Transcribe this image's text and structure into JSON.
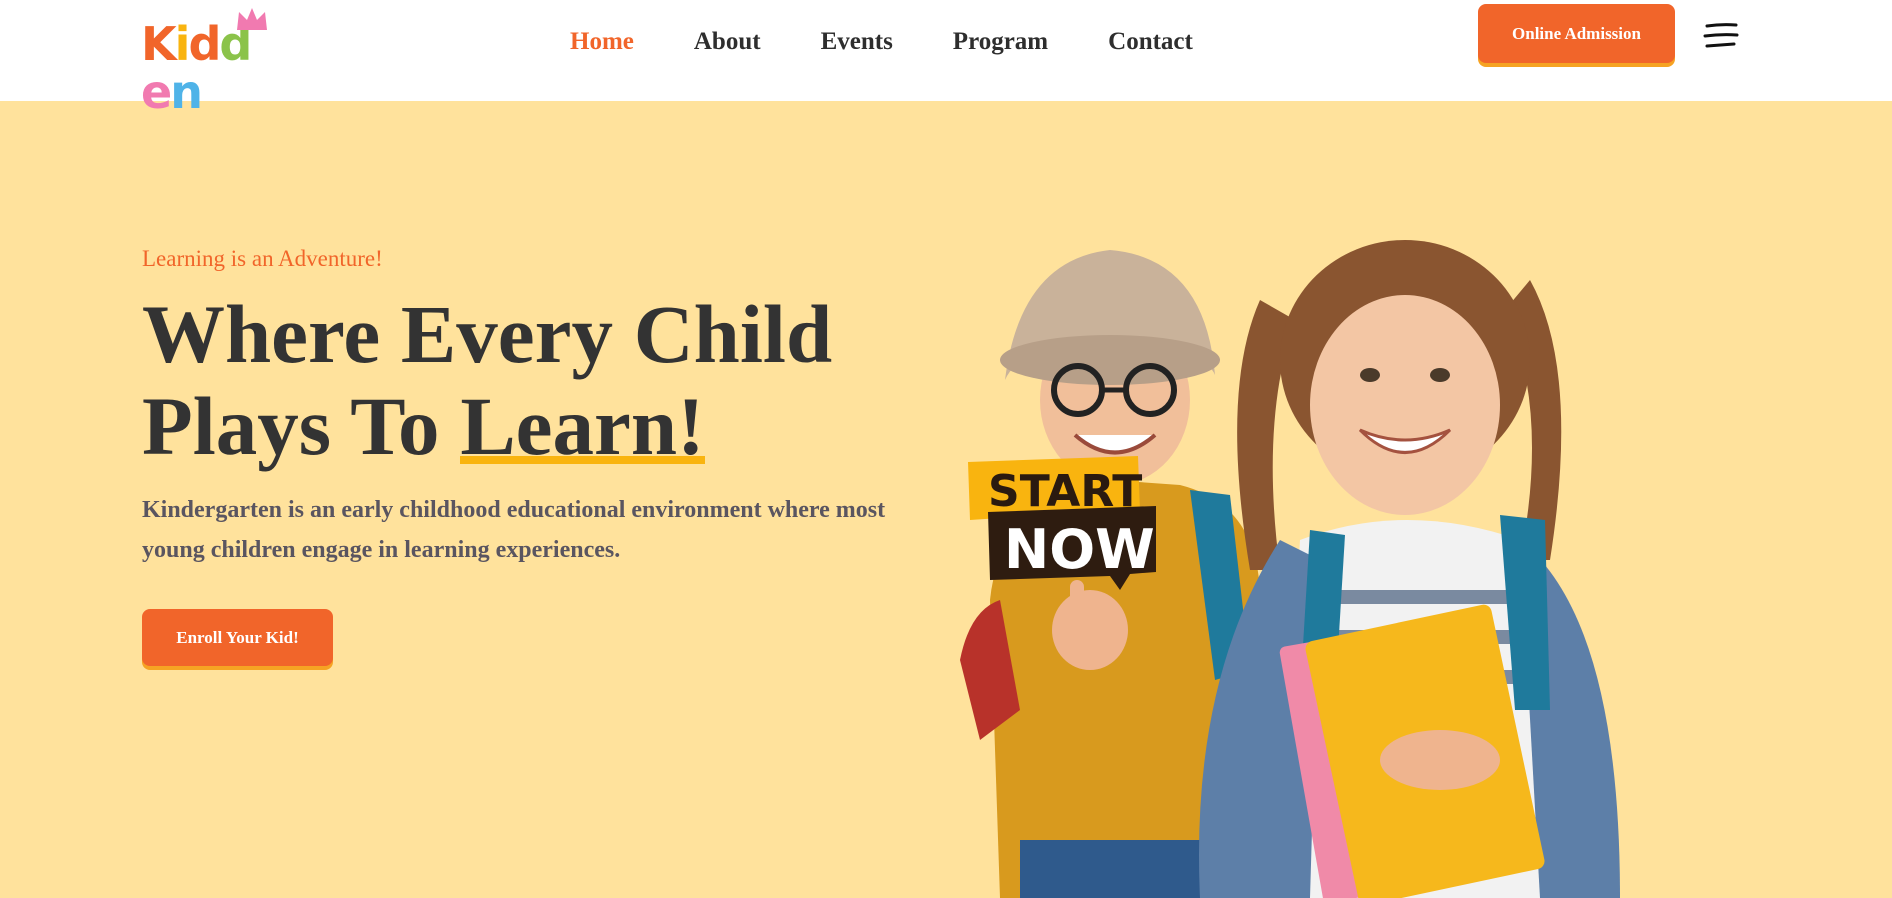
{
  "brand": {
    "logo_text": "Kidden",
    "logo_letters": [
      "K",
      "i",
      "d",
      "d",
      "e",
      "n"
    ],
    "logo_colors": [
      "#f1652a",
      "#f9b40f",
      "#f1652a",
      "#8bc34a",
      "#f17ab0",
      "#4fb3e8"
    ],
    "crown_color": "#f17ab0"
  },
  "nav": {
    "items": [
      {
        "label": "Home",
        "active": true
      },
      {
        "label": "About",
        "active": false
      },
      {
        "label": "Events",
        "active": false
      },
      {
        "label": "Program",
        "active": false
      },
      {
        "label": "Contact",
        "active": false
      }
    ],
    "cta_label": "Online Admission",
    "menu_icon": "hamburger-icon"
  },
  "hero": {
    "tagline": "Learning is an Adventure!",
    "headline_line1": "Where Every Child",
    "headline_line2_prefix": "Plays To ",
    "headline_highlight": "Learn!",
    "description": "Kindergarten is an early childhood educational environment where most young children engage in learning experiences.",
    "button_label": "Enroll Your Kid!",
    "badge_line1": "START",
    "badge_line2": "NOW"
  },
  "colors": {
    "accent": "#f1652a",
    "highlight": "#f9b40f",
    "background": "#ffe29c",
    "heading": "#333333"
  }
}
